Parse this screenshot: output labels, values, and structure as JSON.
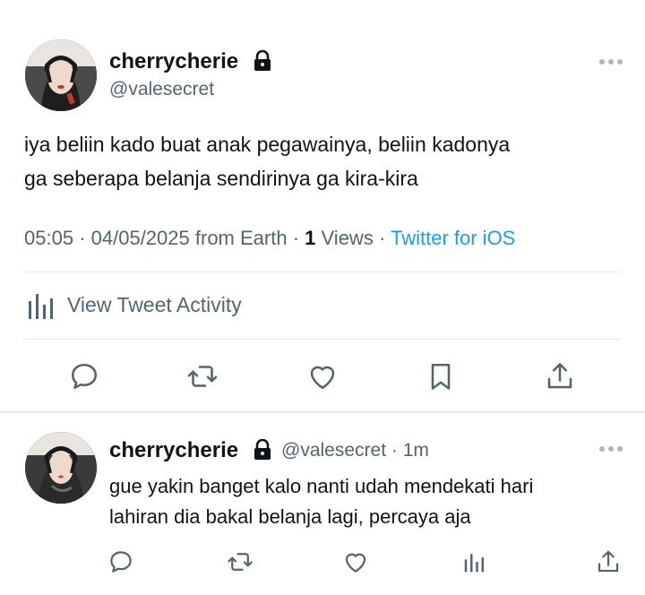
{
  "main_tweet": {
    "author_name": "cherrycherie",
    "handle": "@valesecret",
    "text_line1": "iya beliin kado buat anak pegawainya, beliin kadonya",
    "text_line2": "ga seberapa belanja sendirinya ga kira-kira",
    "time": "05:05",
    "date": "04/05/2025",
    "location": "from Earth",
    "views_count": "1",
    "views_label": "Views",
    "client": "Twitter for iOS",
    "activity_label": "View Tweet Activity"
  },
  "reply": {
    "author_name": "cherrycherie",
    "handle": "@valesecret",
    "age": "1m",
    "text_line1": "gue yakin banget kalo nanti udah mendekati hari",
    "text_line2": "lahiran dia bakal belanja lagi, percaya aja"
  },
  "colors": {
    "accent": "#1d9bf0",
    "secondary_text": "#536471",
    "icon_gray": "#536471",
    "divider": "#e3e7ea"
  },
  "icons": [
    "lock-icon",
    "more-icon",
    "analytics-icon",
    "reply-icon",
    "retweet-icon",
    "like-icon",
    "bookmark-icon",
    "share-icon"
  ]
}
